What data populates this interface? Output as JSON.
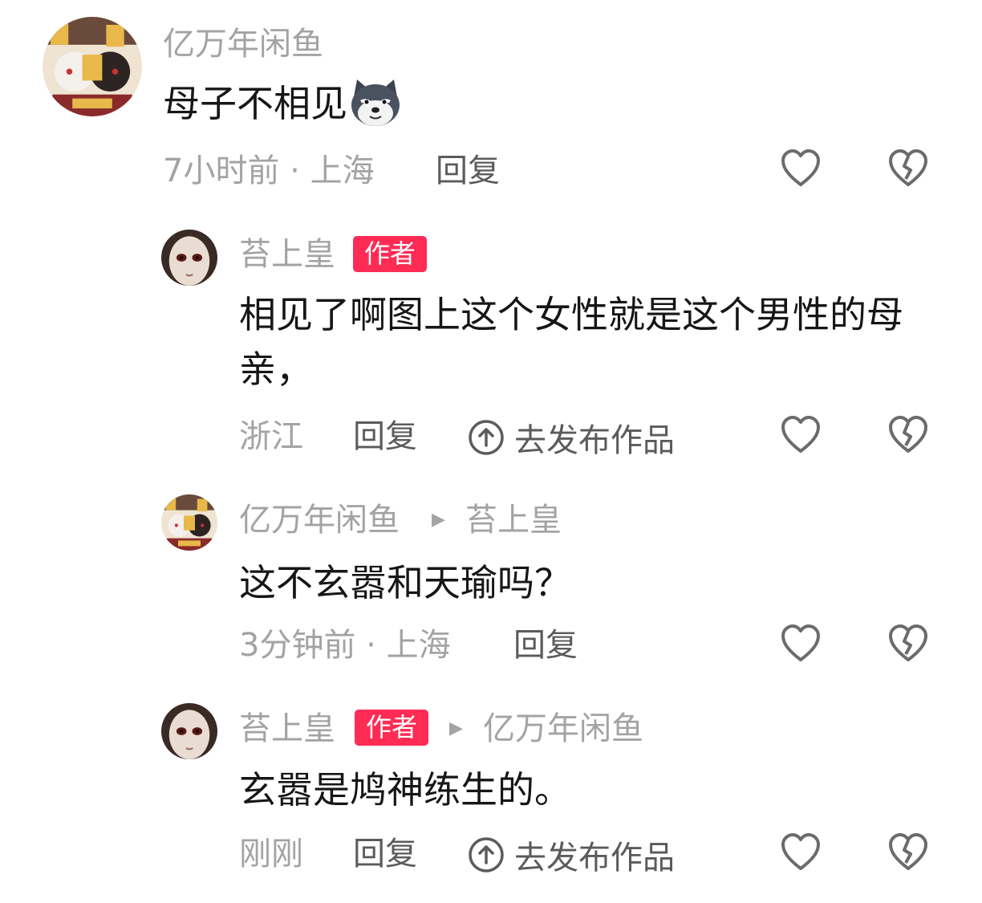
{
  "comments": [
    {
      "author": "亿万年闲鱼",
      "text": "母子不相见",
      "emoji": "wolf-emoji",
      "time_location": "7小时前 · 上海",
      "reply_label": "回复"
    },
    {
      "author": "苔上皇",
      "author_badge": "作者",
      "text": "相见了啊图上这个女性就是这个男性的母亲，",
      "location": "浙江",
      "reply_label": "回复",
      "publish_label": "去发布作品"
    },
    {
      "author": "亿万年闲鱼",
      "reply_to": "苔上皇",
      "text": "这不玄嚣和天瑜吗？",
      "time_location": "3分钟前 · 上海",
      "reply_label": "回复"
    },
    {
      "author": "苔上皇",
      "author_badge": "作者",
      "reply_to": "亿万年闲鱼",
      "text": "玄嚣是鸠神练生的。",
      "time": "刚刚",
      "reply_label": "回复",
      "publish_label": "去发布作品"
    }
  ],
  "icons": {
    "like": "heart-outline-icon",
    "dislike": "broken-heart-icon",
    "publish": "upload-circle-icon",
    "reply_to_arrow": "triangle-right-icon"
  },
  "colors": {
    "author_badge": "#fe2c55",
    "secondary_text": "#a3a3a3",
    "action_text": "#5b5b5b",
    "primary_text": "#161616"
  }
}
